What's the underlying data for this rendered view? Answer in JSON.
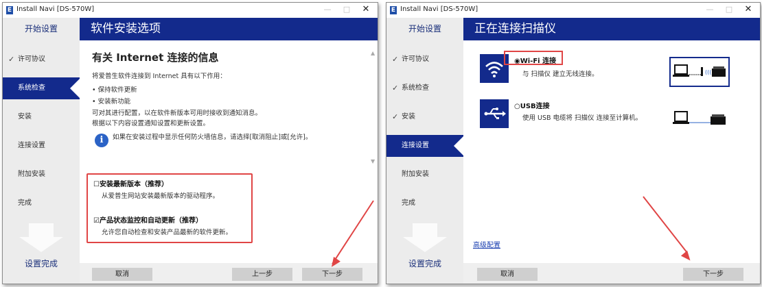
{
  "window1": {
    "title": "Install Navi [DS-570W]",
    "app_icon": "E",
    "controls": {
      "minimize": "—",
      "maximize": "□",
      "close": "✕"
    },
    "sidebar": {
      "header": "开始设置",
      "items": [
        {
          "label": "许可协议",
          "checked": true
        },
        {
          "label": "系统检查",
          "active": true
        },
        {
          "label": "安装"
        },
        {
          "label": "连接设置"
        },
        {
          "label": "附加安装"
        },
        {
          "label": "完成"
        }
      ],
      "footer": "设置完成",
      "check_glyph": "✓"
    },
    "header_title": "软件安装选项",
    "content": {
      "heading": "有关 Internet 连接的信息",
      "intro": "将爱普生软件连接到 Internet 具有以下作用：",
      "bullets": [
        "保持软件更新",
        "安装新功能"
      ],
      "line1": "可对其进行配置，以在软件新版本可用时接收到通知消息。",
      "line2": "根据以下内容设置通知设置和更新设置。",
      "info_icon": "i",
      "firewall_note": "如果在安装过程中显示任何防火墙信息，请选择[取消阻止]或[允许]。",
      "options": [
        {
          "checkbox": "☐",
          "title": "安装最新版本（推荐）",
          "desc": "从爱普生网站安装最新版本的驱动程序。"
        },
        {
          "checkbox": "☑",
          "title": "产品状态监控和自动更新（推荐）",
          "desc": "允许您自动检查和安装产品最新的软件更新。"
        }
      ],
      "scroll_up": "▲",
      "scroll_down": "▼"
    },
    "buttons": {
      "cancel": "取消",
      "back": "上一步",
      "next": "下一步"
    }
  },
  "window2": {
    "title": "Install Navi [DS-570W]",
    "app_icon": "E",
    "controls": {
      "minimize": "—",
      "maximize": "□",
      "close": "✕"
    },
    "sidebar": {
      "header": "开始设置",
      "items": [
        {
          "label": "许可协议",
          "checked": true
        },
        {
          "label": "系统检查",
          "checked": true
        },
        {
          "label": "安装",
          "checked": true
        },
        {
          "label": "连接设置",
          "active": true
        },
        {
          "label": "附加安装"
        },
        {
          "label": "完成"
        }
      ],
      "footer": "设置完成",
      "check_glyph": "✓"
    },
    "header_title": "正在连接扫描仪",
    "connections": [
      {
        "radio": "◉",
        "label": "Wi-Fi 连接",
        "desc": "与 扫描仪 建立无线连接。",
        "icon": "wifi-icon",
        "selected": true
      },
      {
        "radio": "○",
        "label": "USB连接",
        "desc": "使用 USB 电缆将 扫描仪 连接至计算机。",
        "icon": "usb-icon",
        "selected": false
      }
    ],
    "advanced_link": "高级配置",
    "buttons": {
      "cancel": "取消",
      "next": "下一步"
    }
  },
  "colors": {
    "brand_blue": "#132a8c",
    "highlight_red": "#e04545",
    "sidebar_bg": "#ececec"
  }
}
